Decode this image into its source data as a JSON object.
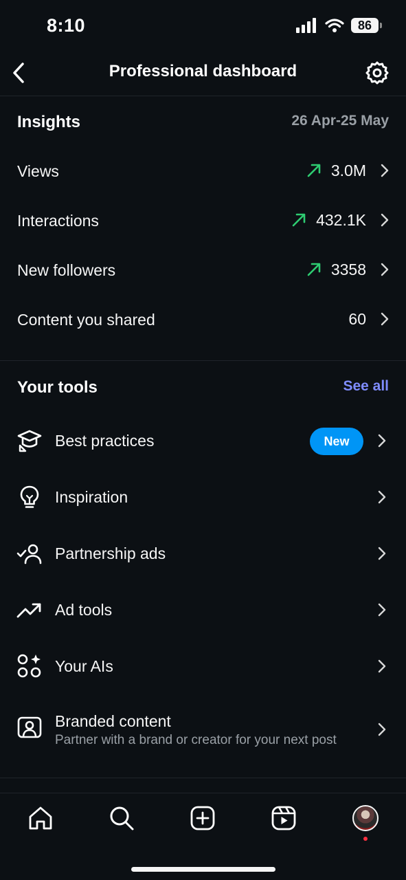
{
  "status_bar": {
    "time": "8:10",
    "battery": "86"
  },
  "header": {
    "title": "Professional dashboard"
  },
  "insights": {
    "title": "Insights",
    "date_range": "26 Apr-25 May",
    "metrics": [
      {
        "label": "Views",
        "value": "3.0M",
        "trend": "up"
      },
      {
        "label": "Interactions",
        "value": "432.1K",
        "trend": "up"
      },
      {
        "label": "New followers",
        "value": "3358",
        "trend": "up"
      },
      {
        "label": "Content you shared",
        "value": "60",
        "trend": ""
      }
    ]
  },
  "tools": {
    "title": "Your tools",
    "see_all": "See all",
    "items": [
      {
        "label": "Best practices",
        "icon": "graduation-cap-icon",
        "badge": "New"
      },
      {
        "label": "Inspiration",
        "icon": "lightbulb-icon"
      },
      {
        "label": "Partnership ads",
        "icon": "person-check-icon"
      },
      {
        "label": "Ad tools",
        "icon": "trending-up-icon"
      },
      {
        "label": "Your AIs",
        "icon": "ai-circles-icon"
      },
      {
        "label": "Branded content",
        "sublabel": "Partner with a brand or creator for your next post",
        "icon": "branded-content-icon"
      }
    ]
  },
  "nav": {
    "items": [
      "home-icon",
      "search-icon",
      "create-icon",
      "reels-icon",
      "profile-avatar"
    ]
  },
  "colors": {
    "background": "#0c1014",
    "trend_up": "#2ecc71",
    "link": "#7f8cff",
    "badge": "#0095f6"
  }
}
